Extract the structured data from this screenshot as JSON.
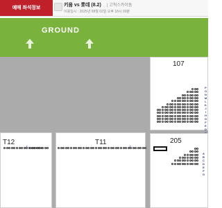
{
  "header": {
    "active_tab": "예매 좌석정보",
    "match_title": "키움 vs 롯데 (8.2)",
    "venue": "| 고척스카이돔",
    "datetime": "이용일시 : 2025년 08월 02일 오후 18시 00분"
  },
  "field": {
    "label": "GROUND",
    "arrow_icon": "up-arrow-icon"
  },
  "sections": {
    "s107": {
      "label": "107",
      "rows": [
        "P",
        "O",
        "N",
        "M",
        "L",
        "K",
        "J",
        "I",
        "H",
        "G",
        "F",
        "E",
        "D",
        "C",
        "B",
        "A"
      ]
    },
    "s205": {
      "label": "205",
      "rows": [
        "A",
        "B",
        "C",
        "D",
        "E",
        "F",
        "G"
      ]
    },
    "t12": {
      "label": "T12",
      "row_marker": "①"
    },
    "t11": {
      "label": "T11",
      "row_marker": "①"
    }
  },
  "colors": {
    "accent": "#c0202a",
    "field": "#79b33d",
    "aisle": "#ababab",
    "row_letter": "#2d3a8c"
  }
}
